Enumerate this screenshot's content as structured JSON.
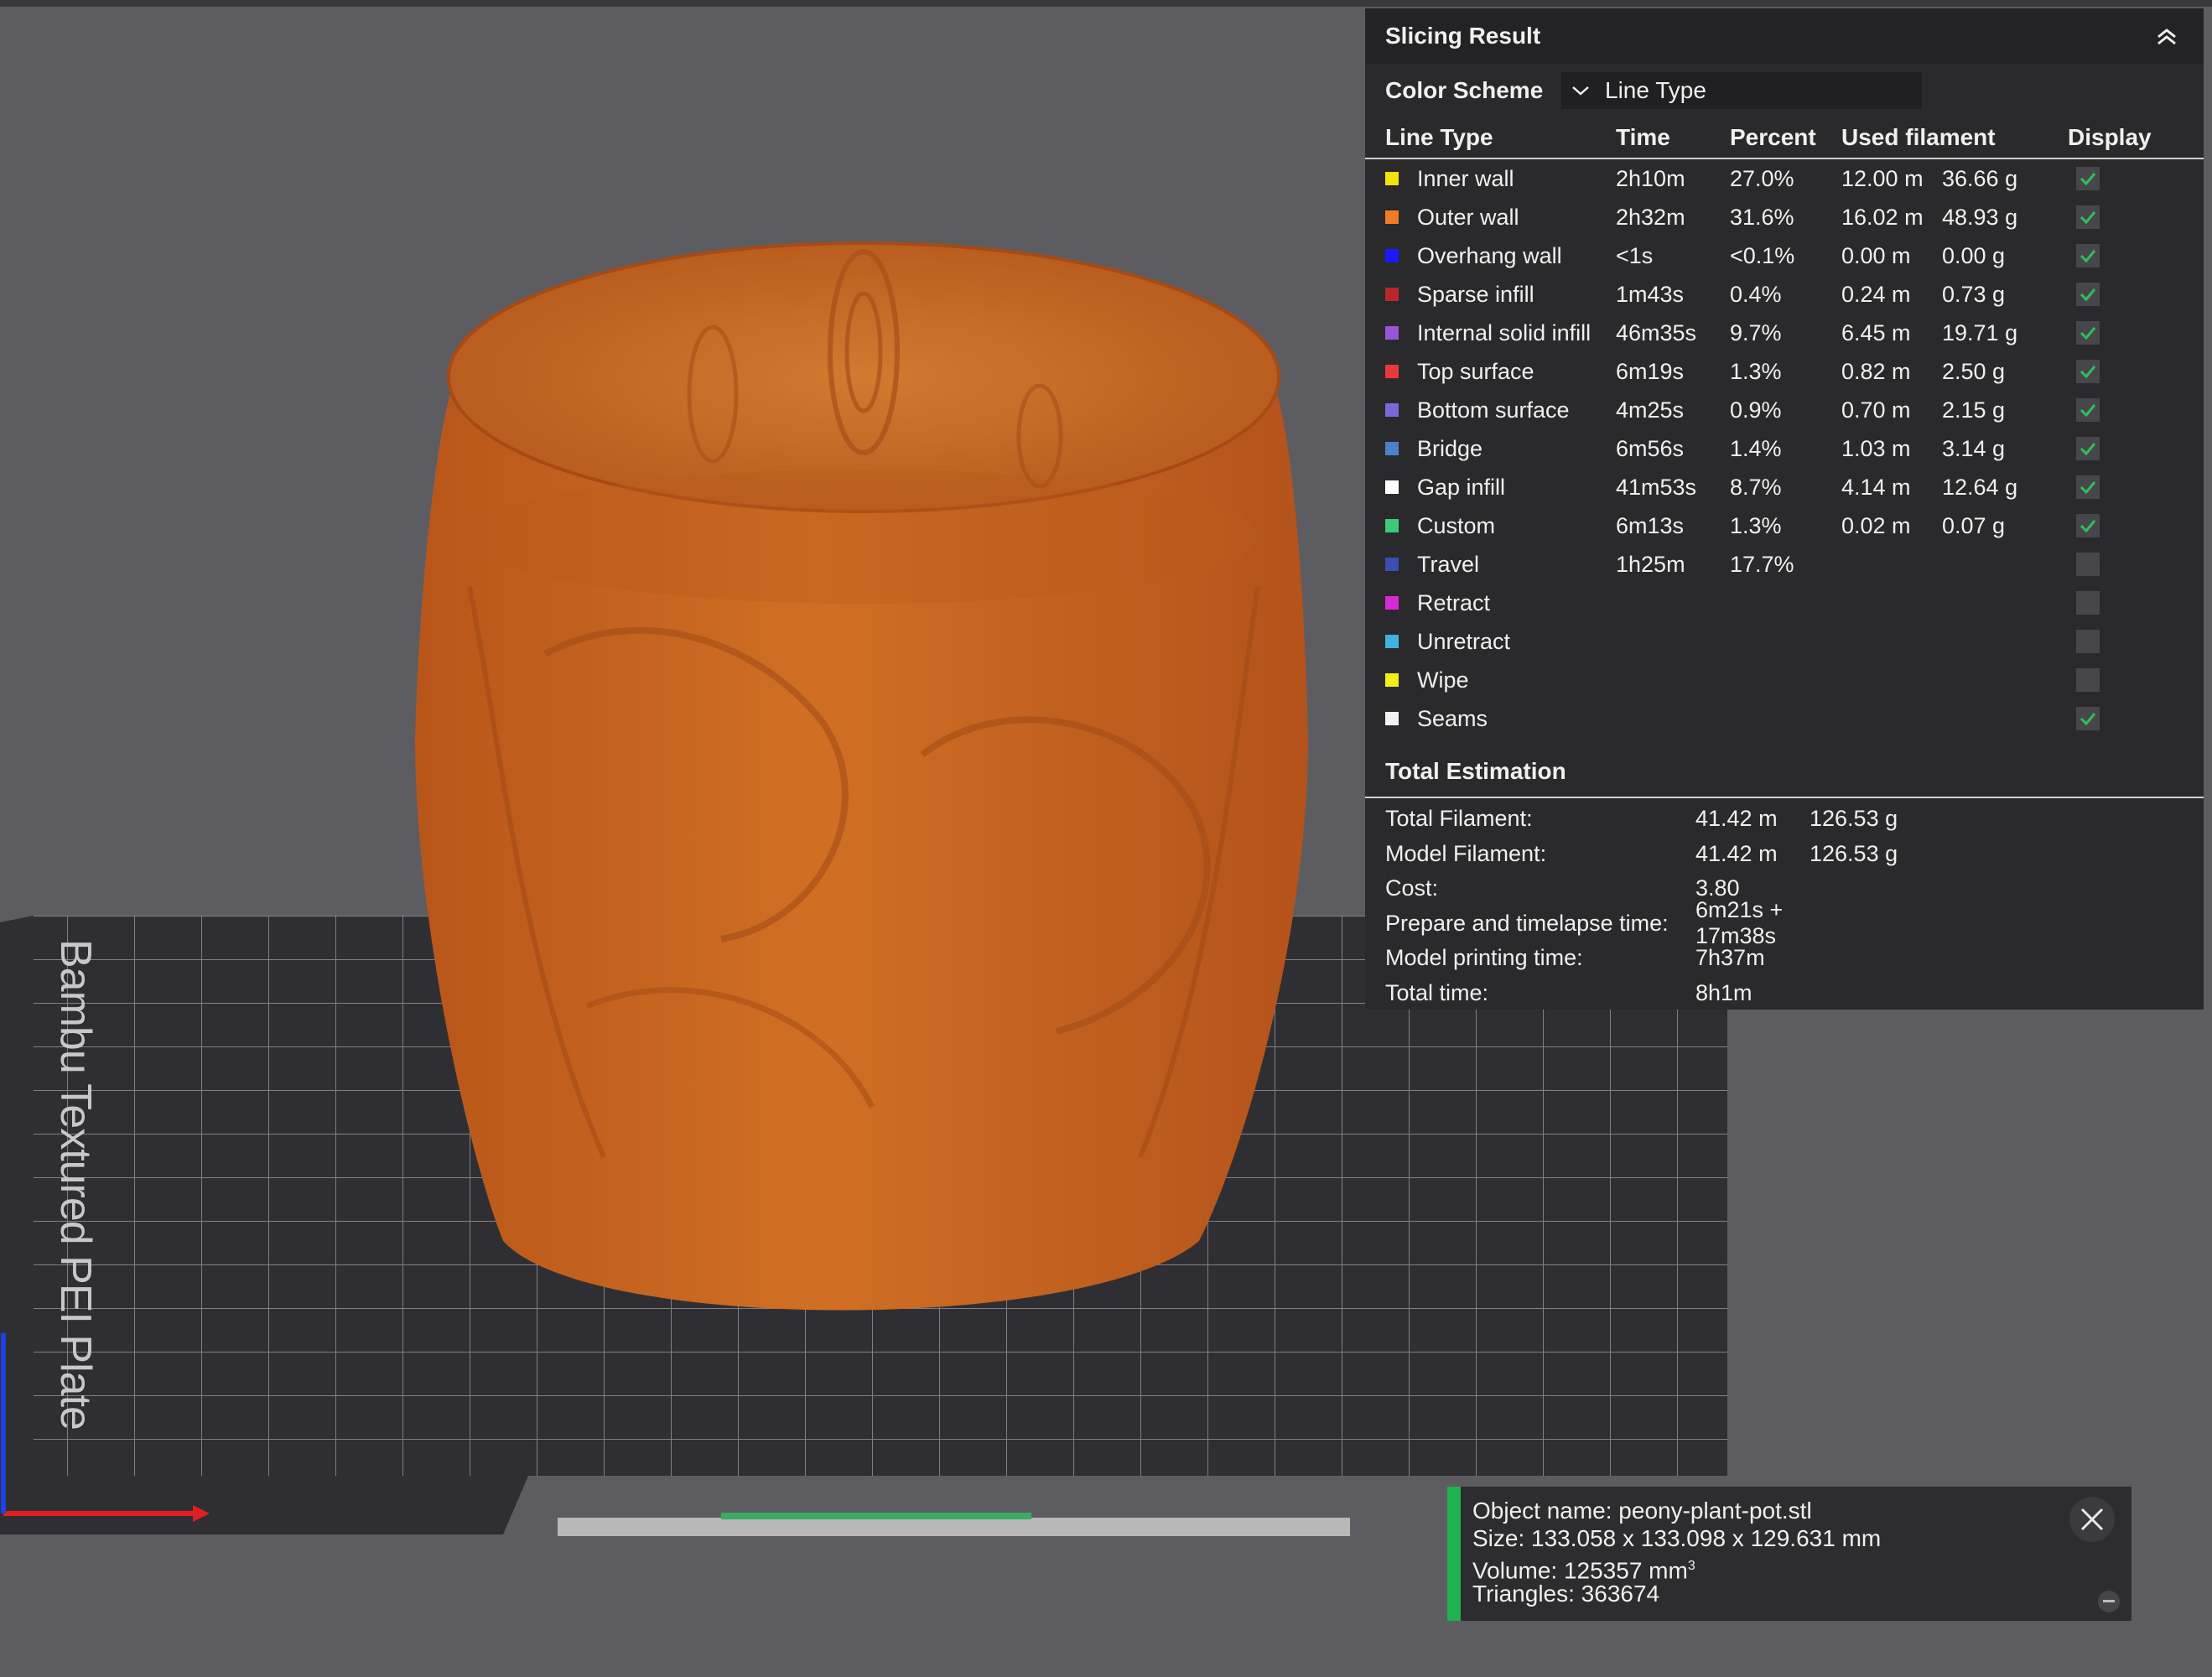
{
  "panel": {
    "title": "Slicing Result",
    "color_scheme_label": "Color Scheme",
    "color_scheme_value": "Line Type",
    "columns": {
      "line_type": "Line Type",
      "time": "Time",
      "percent": "Percent",
      "used_filament": "Used filament",
      "display": "Display"
    },
    "rows": [
      {
        "name": "Inner wall",
        "color": "#f4e20c",
        "time": "2h10m",
        "percent": "27.0%",
        "length": "12.00 m",
        "weight": "36.66 g",
        "display": true
      },
      {
        "name": "Outer wall",
        "color": "#f07a2a",
        "time": "2h32m",
        "percent": "31.6%",
        "length": "16.02 m",
        "weight": "48.93 g",
        "display": true
      },
      {
        "name": "Overhang wall",
        "color": "#1a1aff",
        "time": "<1s",
        "percent": "<0.1%",
        "length": "0.00 m",
        "weight": "0.00 g",
        "display": true
      },
      {
        "name": "Sparse infill",
        "color": "#b8282b",
        "time": "1m43s",
        "percent": "0.4%",
        "length": "0.24 m",
        "weight": "0.73 g",
        "display": true
      },
      {
        "name": "Internal solid infill",
        "color": "#9a55d6",
        "time": "46m35s",
        "percent": "9.7%",
        "length": "6.45 m",
        "weight": "19.71 g",
        "display": true
      },
      {
        "name": "Top surface",
        "color": "#e83838",
        "time": "6m19s",
        "percent": "1.3%",
        "length": "0.82 m",
        "weight": "2.50 g",
        "display": true
      },
      {
        "name": "Bottom surface",
        "color": "#7b68d8",
        "time": "4m25s",
        "percent": "0.9%",
        "length": "0.70 m",
        "weight": "2.15 g",
        "display": true
      },
      {
        "name": "Bridge",
        "color": "#4f7fcf",
        "time": "6m56s",
        "percent": "1.4%",
        "length": "1.03 m",
        "weight": "3.14 g",
        "display": true
      },
      {
        "name": "Gap infill",
        "color": "#ffffff",
        "time": "41m53s",
        "percent": "8.7%",
        "length": "4.14 m",
        "weight": "12.64 g",
        "display": true
      },
      {
        "name": "Custom",
        "color": "#3ec97a",
        "time": "6m13s",
        "percent": "1.3%",
        "length": "0.02 m",
        "weight": "0.07 g",
        "display": true
      },
      {
        "name": "Travel",
        "color": "#3a4fb0",
        "time": "1h25m",
        "percent": "17.7%",
        "length": "",
        "weight": "",
        "display": false
      },
      {
        "name": "Retract",
        "color": "#d62ad6",
        "time": "",
        "percent": "",
        "length": "",
        "weight": "",
        "display": false
      },
      {
        "name": "Unretract",
        "color": "#3fb2e0",
        "time": "",
        "percent": "",
        "length": "",
        "weight": "",
        "display": false
      },
      {
        "name": "Wipe",
        "color": "#f2ee18",
        "time": "",
        "percent": "",
        "length": "",
        "weight": "",
        "display": false
      },
      {
        "name": "Seams",
        "color": "#f2f2f2",
        "time": "",
        "percent": "",
        "length": "",
        "weight": "",
        "display": true
      }
    ],
    "total_title": "Total Estimation",
    "estimation": [
      {
        "label": "Total Filament:",
        "v1": "41.42 m",
        "v2": "126.53 g"
      },
      {
        "label": "Model Filament:",
        "v1": "41.42 m",
        "v2": "126.53 g"
      },
      {
        "label": "Cost:",
        "v1": "3.80",
        "v2": ""
      },
      {
        "label": "Prepare and timelapse time:",
        "v1": "6m21s + 17m38s",
        "v2": ""
      },
      {
        "label": "Model printing time:",
        "v1": "7h37m",
        "v2": ""
      },
      {
        "label": "Total time:",
        "v1": "8h1m",
        "v2": ""
      }
    ]
  },
  "object_info": {
    "name": "Object name: peony-plant-pot.stl",
    "size": "Size: 133.058 x 133.098 x 129.631 mm",
    "volume": "Volume: 125357 mm",
    "volume_unit_sup": "3",
    "triangles": "Triangles: 363674"
  },
  "plate": {
    "label": "Bambu Textured PEI Plate"
  },
  "colors": {
    "model_orange": "#c4621e",
    "check_green": "#2fbf5a",
    "accent_green": "#1fb24e"
  }
}
